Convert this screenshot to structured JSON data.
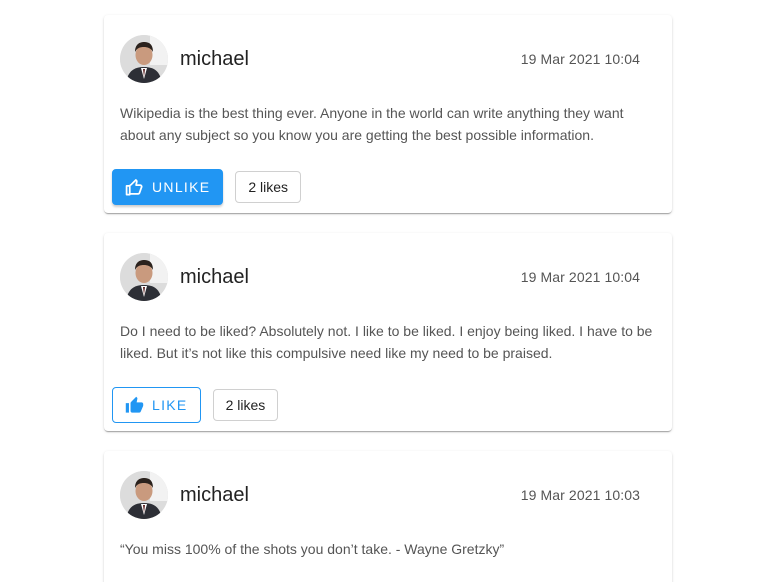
{
  "posts": [
    {
      "author": "michael",
      "timestamp": "19 Mar 2021 10:04",
      "text": "Wikipedia is the best thing ever. Anyone in the world can write anything they want about any subject so you know you are getting the best possible information.",
      "like_button_label": "UNLIKE",
      "likes": "2 likes",
      "liked": true,
      "icon": "thumb-up-icon"
    },
    {
      "author": "michael",
      "timestamp": "19 Mar 2021 10:04",
      "text": "Do I need to be liked? Absolutely not. I like to be liked. I enjoy being liked. I have to be liked. But it’s not like this compulsive need like my need to be praised.",
      "like_button_label": "LIKE",
      "likes": "2 likes",
      "liked": false,
      "icon": "thumb-up-icon"
    },
    {
      "author": "michael",
      "timestamp": "19 Mar 2021 10:03",
      "text": "“You miss 100% of the shots you don’t take. - Wayne Gretzky”",
      "icon": "thumb-up-icon"
    }
  ],
  "colors": {
    "accent": "#2196f3",
    "text_primary": "#222222",
    "text_secondary": "#555555",
    "card_bg": "#ffffff"
  }
}
